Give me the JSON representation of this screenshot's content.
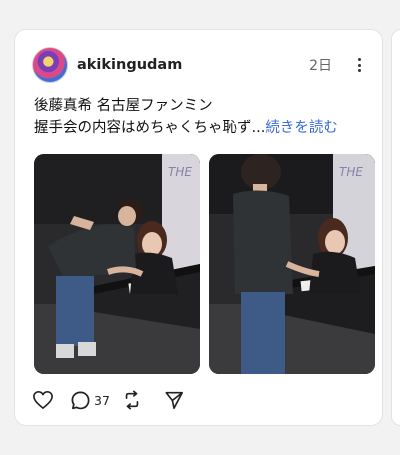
{
  "post": {
    "username": "akikingudam",
    "time": "2日",
    "text_line1": "後藤真希 名古屋ファンミン",
    "text_line2": "握手会の内容はめちゃくちゃ恥ず...",
    "read_more": "続きを読む",
    "photo_sign_text": "THE"
  },
  "actions": {
    "reply_count": "37"
  },
  "icons": [
    "more-icon",
    "heart-icon",
    "reply-icon",
    "repost-icon",
    "share-icon"
  ]
}
